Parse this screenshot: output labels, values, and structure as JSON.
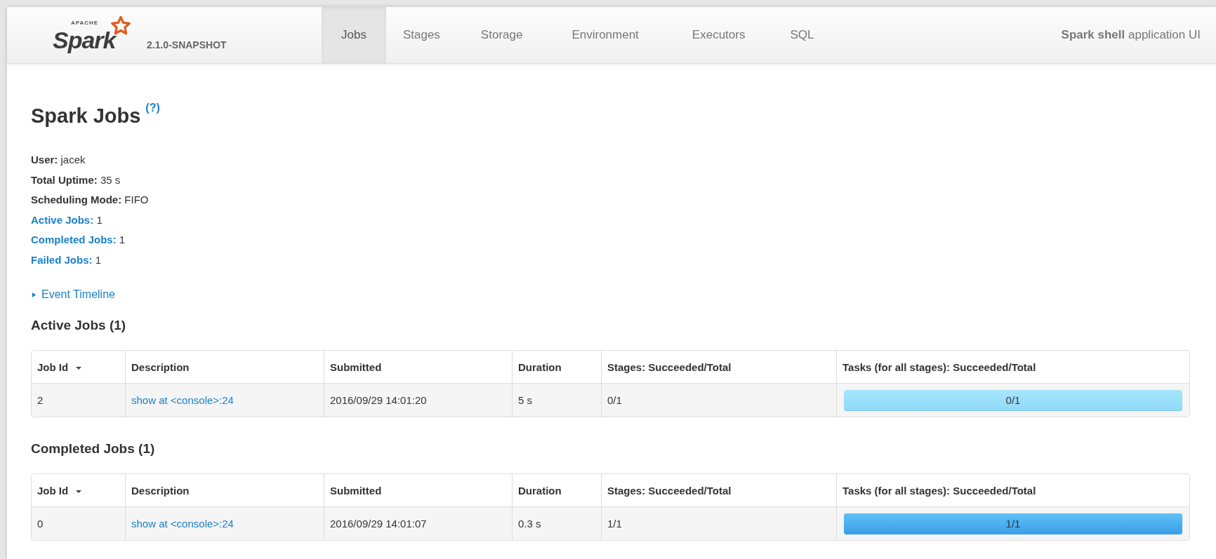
{
  "navbar": {
    "logo": {
      "small": "APACHE",
      "word": "Spark"
    },
    "version": "2.1.0-SNAPSHOT",
    "tabs": [
      {
        "label": "Jobs",
        "selected": true
      },
      {
        "label": "Stages",
        "selected": false
      },
      {
        "label": "Storage",
        "selected": false
      },
      {
        "label": "Environment",
        "selected": false
      },
      {
        "label": "Executors",
        "selected": false
      },
      {
        "label": "SQL",
        "selected": false
      }
    ],
    "app_title": "**Spark shell** application UI"
  },
  "page": {
    "title": "Spark Jobs",
    "help": "(?)",
    "info": [
      {
        "kind": "plain",
        "label": "User:",
        "value": "jacek"
      },
      {
        "kind": "plain",
        "label": "Total Uptime:",
        "value": "35 s"
      },
      {
        "kind": "plain",
        "label": "Scheduling Mode:",
        "value": "FIFO"
      },
      {
        "kind": "link",
        "label": "Active Jobs:",
        "value": "1"
      },
      {
        "kind": "link",
        "label": "Completed Jobs:",
        "value": "1"
      },
      {
        "kind": "link",
        "label": "Failed Jobs:",
        "value": "1"
      }
    ],
    "timeline": {
      "label": "Event Timeline",
      "expanded": false
    },
    "sections": [
      {
        "title": "Active Jobs (1)",
        "columns": [
          "Job Id",
          "Description",
          "Submitted",
          "Duration",
          "Stages: Succeeded/Total",
          "Tasks (for all stages): Succeeded/Total"
        ],
        "rows": [
          {
            "job_id": "2",
            "description": "show at <console>:24",
            "submitted": "2016/09/29 14:01:20",
            "duration": "5 s",
            "stages": "0/1",
            "tasks": "0/1",
            "level": 0
          }
        ]
      },
      {
        "title": "Completed Jobs (1)",
        "columns": [
          "Job Id",
          "Description",
          "Submitted",
          "Duration",
          "Stages: Succeeded/Total",
          "Tasks (for all stages): Succeeded/Total"
        ],
        "rows": [
          {
            "job_id": "0",
            "description": "show at <console>:24",
            "submitted": "2016/09/29 14:01:07",
            "duration": "0.3 s",
            "stages": "1/1",
            "tasks": "1/1",
            "level": 1
          }
        ]
      }
    ]
  }
}
